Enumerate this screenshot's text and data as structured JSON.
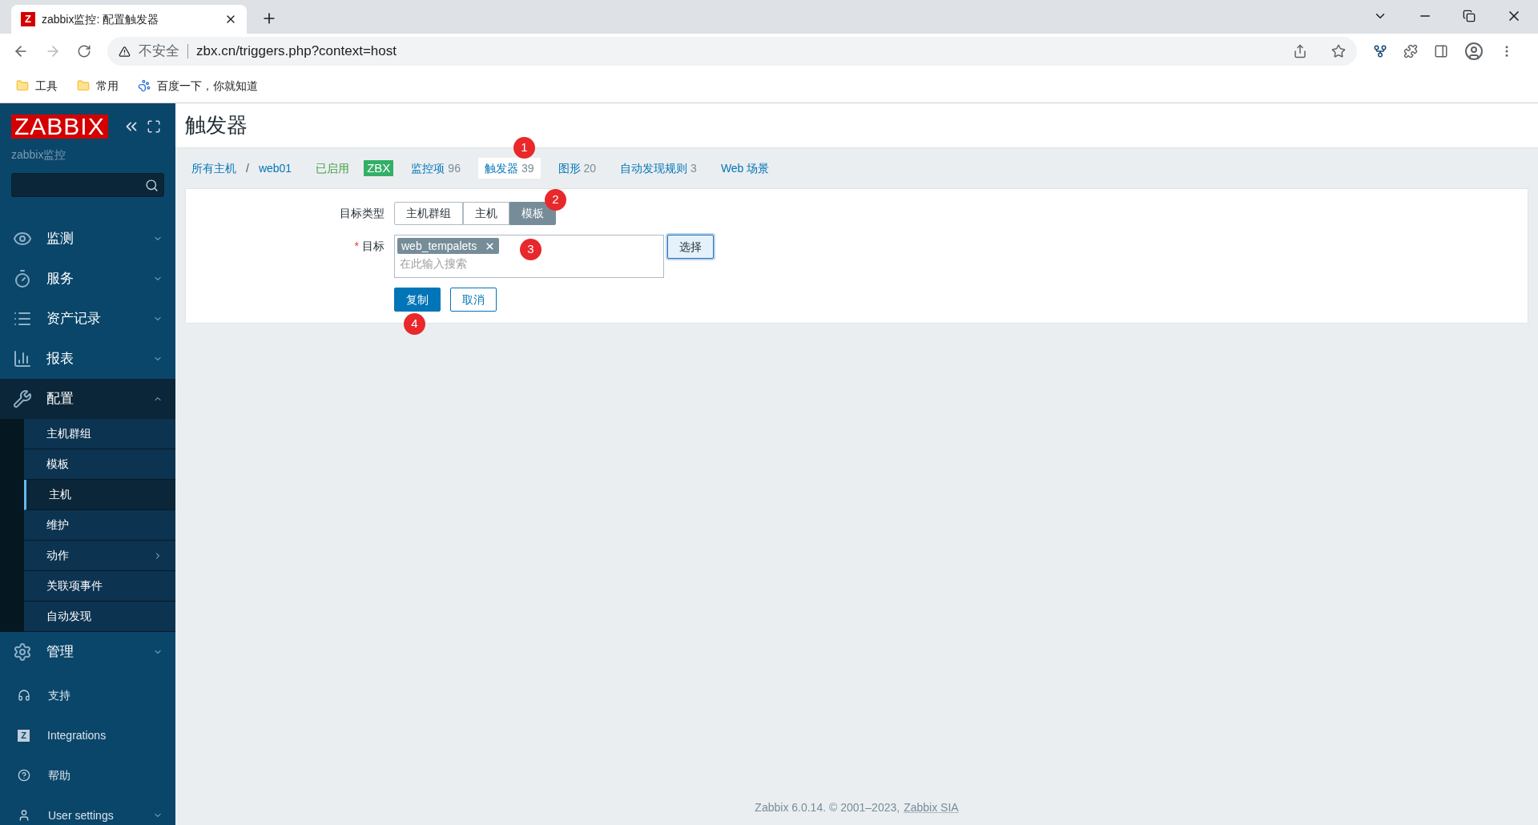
{
  "browser": {
    "favicon": "Z",
    "tab_title": "zabbix监控: 配置触发器",
    "security": "不安全",
    "url": "zbx.cn/triggers.php?context=host",
    "bookmarks": [
      "工具",
      "常用",
      "百度一下，你就知道"
    ]
  },
  "sidebar": {
    "logo": "ZABBIX",
    "server_name": "zabbix监控",
    "menu": [
      {
        "label": "监测",
        "expanded": false
      },
      {
        "label": "服务",
        "expanded": false
      },
      {
        "label": "资产记录",
        "expanded": false
      },
      {
        "label": "报表",
        "expanded": false
      },
      {
        "label": "配置",
        "expanded": true,
        "children": [
          {
            "label": "主机群组",
            "selected": false,
            "has_submenu": false
          },
          {
            "label": "模板",
            "selected": false,
            "has_submenu": false
          },
          {
            "label": "主机",
            "selected": true,
            "has_submenu": false
          },
          {
            "label": "维护",
            "selected": false,
            "has_submenu": false
          },
          {
            "label": "动作",
            "selected": false,
            "has_submenu": true
          },
          {
            "label": "关联项事件",
            "selected": false,
            "has_submenu": false
          },
          {
            "label": "自动发现",
            "selected": false,
            "has_submenu": false
          }
        ]
      },
      {
        "label": "管理",
        "expanded": false
      }
    ],
    "bottom_menu": [
      {
        "label": "支持",
        "has_submenu": false
      },
      {
        "label": "Integrations",
        "has_submenu": false,
        "icon_letter": "Z"
      },
      {
        "label": "帮助",
        "has_submenu": false
      },
      {
        "label": "User settings",
        "has_submenu": true
      }
    ]
  },
  "page": {
    "title": "触发器",
    "breadcrumb": [
      "所有主机",
      "web01"
    ],
    "breadcrumb_separator": "/",
    "status": "已启用",
    "availability": "ZBX",
    "tabs": [
      {
        "label": "监控项",
        "count": "96",
        "selected": false
      },
      {
        "label": "触发器",
        "count": "39",
        "selected": true,
        "marker": "1"
      },
      {
        "label": "图形",
        "count": "20",
        "selected": false
      },
      {
        "label": "自动发现规则",
        "count": "3",
        "selected": false
      },
      {
        "label": "Web 场景",
        "selected": false
      }
    ],
    "form": {
      "target_type": {
        "label": "目标类型",
        "marker": "2",
        "options": [
          {
            "label": "主机群组",
            "selected": false
          },
          {
            "label": "主机",
            "selected": false
          },
          {
            "label": "模板",
            "selected": true
          }
        ]
      },
      "target": {
        "label": "目标",
        "required_mark": "*",
        "marker": "3",
        "tags": [
          "web_tempalets"
        ],
        "placeholder": "在此输入搜索",
        "select_button": "选择"
      },
      "buttons": [
        {
          "label": "复制",
          "kind": "primary",
          "marker": "4"
        },
        {
          "label": "取消",
          "kind": "secondary"
        }
      ]
    }
  },
  "footer": {
    "text": "Zabbix 6.0.14. © 2001–2023,",
    "link": "Zabbix SIA"
  }
}
